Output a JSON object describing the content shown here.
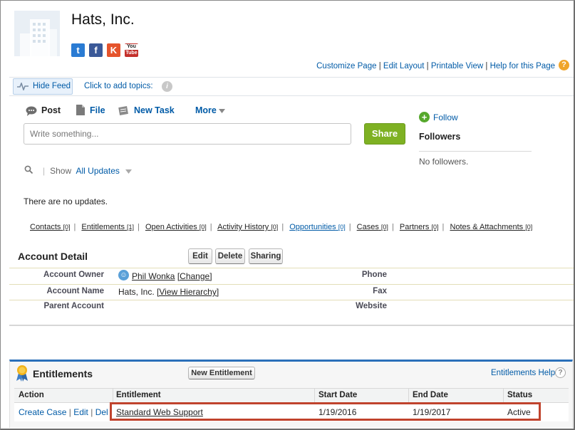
{
  "account": {
    "name": "Hats, Inc.",
    "social": [
      {
        "name": "twitter-icon",
        "glyph": "t",
        "color": "#2a7bd3"
      },
      {
        "name": "facebook-icon",
        "glyph": "f",
        "color": "#3b5998"
      },
      {
        "name": "klout-icon",
        "glyph": "K",
        "color": "#e5542c"
      },
      {
        "name": "youtube-icon",
        "glyph": "You",
        "color": "#c4302b"
      }
    ]
  },
  "top_links": {
    "customize": "Customize Page",
    "edit_layout": "Edit Layout",
    "printable": "Printable View",
    "help": "Help for this Page",
    "sep": "|"
  },
  "feed": {
    "hide_feed": "Hide Feed",
    "add_topics": "Click to add topics:",
    "tabs": {
      "post": "Post",
      "file": "File",
      "new_task": "New Task",
      "more": "More"
    },
    "composer_placeholder": "Write something...",
    "share": "Share",
    "show_label": "Show",
    "show_value": "All Updates",
    "no_updates": "There are no updates."
  },
  "followers": {
    "follow": "Follow",
    "title": "Followers",
    "empty": "No followers."
  },
  "related_links": [
    {
      "label": "Contacts",
      "count": "[0]"
    },
    {
      "label": "Entitlements",
      "count": "[1]"
    },
    {
      "label": "Open Activities",
      "count": "[0]"
    },
    {
      "label": "Activity History",
      "count": "[0]"
    },
    {
      "label": "Opportunities",
      "count": "[0]"
    },
    {
      "label": "Cases",
      "count": "[0]"
    },
    {
      "label": "Partners",
      "count": "[0]"
    },
    {
      "label": "Notes & Attachments",
      "count": "[0]"
    }
  ],
  "account_detail": {
    "title": "Account Detail",
    "buttons": {
      "edit": "Edit",
      "delete": "Delete",
      "sharing": "Sharing"
    },
    "fields": {
      "owner_label": "Account Owner",
      "owner_value": "Phil Wonka",
      "owner_change": "[Change]",
      "name_label": "Account Name",
      "name_value": "Hats, Inc.",
      "name_hierarchy": "[View Hierarchy]",
      "parent_label": "Parent Account",
      "phone_label": "Phone",
      "fax_label": "Fax",
      "website_label": "Website"
    }
  },
  "entitlements": {
    "title": "Entitlements",
    "new_button": "New Entitlement",
    "help": "Entitlements Help",
    "columns": {
      "action": "Action",
      "entitlement": "Entitlement",
      "start": "Start Date",
      "end": "End Date",
      "status": "Status"
    },
    "row": {
      "create_case": "Create Case",
      "edit": "Edit",
      "del": "Del",
      "sep": "|",
      "entitlement": "Standard Web Support",
      "start": "1/19/2016",
      "end": "1/19/2017",
      "status": "Active"
    }
  }
}
